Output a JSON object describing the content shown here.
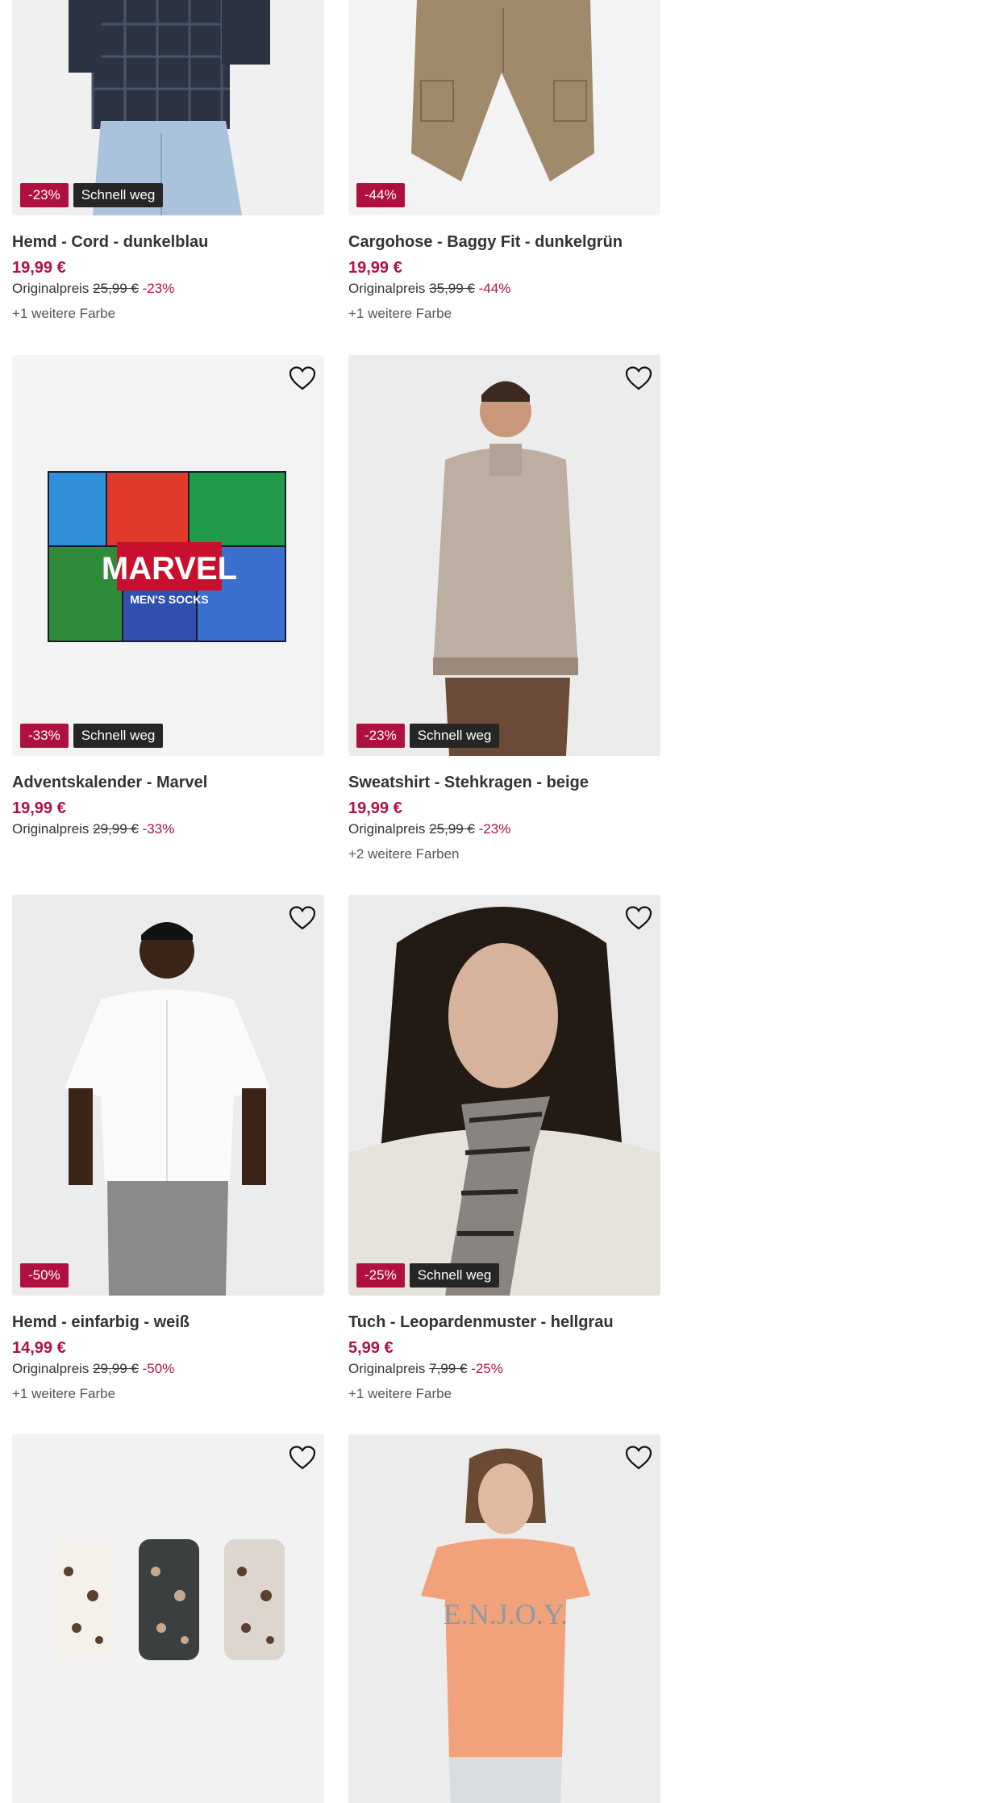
{
  "colors": {
    "sale": "#b0103f",
    "badge_dark": "#262626",
    "image_bg": "#f3f3f3"
  },
  "products": [
    {
      "title": "Hemd - Cord - dunkelblau",
      "price": "19,99 €",
      "orig_label": "Originalpreis",
      "orig_price": "25,99 €",
      "discount": "-23%",
      "badge_discount": "-23%",
      "badge_fast": "Schnell weg",
      "more_colors": "+1 weitere Farbe",
      "icon": "heart-icon"
    },
    {
      "title": "Cargohose - Baggy Fit - dunkelgrün",
      "price": "19,99 €",
      "orig_label": "Originalpreis",
      "orig_price": "35,99 €",
      "discount": "-44%",
      "badge_discount": "-44%",
      "badge_fast": "",
      "more_colors": "+1 weitere Farbe",
      "icon": "heart-icon"
    },
    {
      "title": "Adventskalender - Marvel",
      "price": "19,99 €",
      "orig_label": "Originalpreis",
      "orig_price": "29,99 €",
      "discount": "-33%",
      "badge_discount": "-33%",
      "badge_fast": "Schnell weg",
      "more_colors": "",
      "icon": "heart-icon"
    },
    {
      "title": "Sweatshirt - Stehkragen - beige",
      "price": "19,99 €",
      "orig_label": "Originalpreis",
      "orig_price": "25,99 €",
      "discount": "-23%",
      "badge_discount": "-23%",
      "badge_fast": "Schnell weg",
      "more_colors": "+2 weitere Farben",
      "icon": "heart-icon"
    },
    {
      "title": "Hemd - einfarbig - weiß",
      "price": "14,99 €",
      "orig_label": "Originalpreis",
      "orig_price": "29,99 €",
      "discount": "-50%",
      "badge_discount": "-50%",
      "badge_fast": "",
      "more_colors": "+1 weitere Farbe",
      "icon": "heart-icon"
    },
    {
      "title": "Tuch - Leopardenmuster - hellgrau",
      "price": "5,99 €",
      "orig_label": "Originalpreis",
      "orig_price": "7,99 €",
      "discount": "-25%",
      "badge_discount": "-25%",
      "badge_fast": "Schnell weg",
      "more_colors": "+1 weitere Farbe",
      "icon": "heart-icon"
    },
    {
      "title": "",
      "price": "",
      "orig_label": "",
      "orig_price": "",
      "discount": "",
      "badge_discount": "",
      "badge_fast": "",
      "more_colors": "",
      "icon": "heart-icon"
    },
    {
      "title": "",
      "price": "",
      "orig_label": "",
      "orig_price": "",
      "discount": "",
      "badge_discount": "",
      "badge_fast": "",
      "more_colors": "",
      "icon": "heart-icon"
    }
  ],
  "marvel_box": {
    "logo": "MARVEL",
    "subtitle": "MEN'S SOCKS"
  },
  "tshirt_print": "E.N.J.O.Y."
}
